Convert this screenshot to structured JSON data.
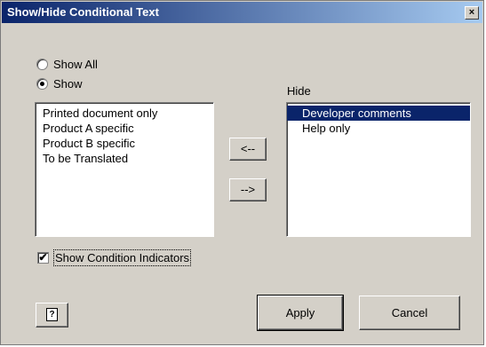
{
  "window": {
    "title": "Show/Hide Conditional Text",
    "close_label": "×"
  },
  "options": {
    "show_all_label": "Show All",
    "show_label": "Show",
    "selected": "show"
  },
  "show_list": {
    "items": [
      "Printed document only",
      "Product A specific",
      "Product B specific",
      "To be Translated"
    ]
  },
  "hide_list": {
    "label": "Hide",
    "items": [
      "Developer comments",
      "Help only"
    ],
    "selected_index": 0
  },
  "move_buttons": {
    "move_left_label": "<--",
    "move_right_label": "-->"
  },
  "indicators": {
    "label": "Show Condition Indicators",
    "checked": true,
    "check_glyph": "✔"
  },
  "footer": {
    "apply_label": "Apply",
    "cancel_label": "Cancel",
    "help_glyph": "?"
  }
}
